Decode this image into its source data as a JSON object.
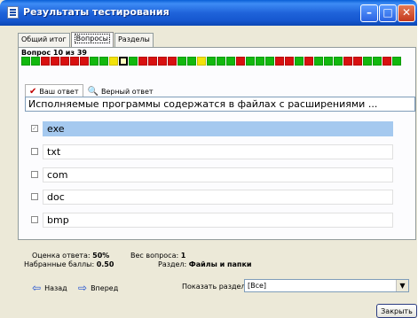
{
  "window": {
    "title": "Результаты тестирования",
    "controls": {
      "minimize": "–",
      "maximize": "□",
      "close": "✕"
    }
  },
  "tabs": [
    {
      "label": "Общий итог",
      "active": false
    },
    {
      "label": "Вопросы",
      "active": true
    },
    {
      "label": "Разделы",
      "active": false
    }
  ],
  "question_counter": "Вопрос 10 из 39",
  "question_grid": [
    "g",
    "g",
    "r",
    "r",
    "r",
    "r",
    "r",
    "g",
    "g",
    "y",
    "cur",
    "g",
    "r",
    "r",
    "r",
    "r",
    "g",
    "g",
    "y",
    "g",
    "g",
    "g",
    "r",
    "g",
    "g",
    "g",
    "r",
    "r",
    "g",
    "r",
    "g",
    "g",
    "g",
    "r",
    "r",
    "g",
    "g",
    "r",
    "g"
  ],
  "colors": {
    "correct": "#12b80e",
    "wrong": "#d81010",
    "partial": "#f2e20a",
    "selected_answer": "#a5c9ef"
  },
  "answer_tabs": [
    {
      "label": "Ваш ответ",
      "icon": "check-icon",
      "active": true
    },
    {
      "label": "Верный ответ",
      "icon": "magnifier-icon",
      "active": false
    }
  ],
  "question_text": "Исполняемые программы содержатся в файлах с расширениями ...",
  "answers": [
    {
      "text": "exe",
      "checked": true,
      "selected": true
    },
    {
      "text": "txt",
      "checked": false,
      "selected": false
    },
    {
      "text": "com",
      "checked": false,
      "selected": false
    },
    {
      "text": "doc",
      "checked": false,
      "selected": false
    },
    {
      "text": "bmp",
      "checked": false,
      "selected": false
    }
  ],
  "stats": {
    "score_label": "Оценка ответа:",
    "score_value": "50%",
    "points_label": "Набранные баллы:",
    "points_value": "0.50",
    "weight_label": "Вес вопроса:",
    "weight_value": "1",
    "section_label": "Раздел:",
    "section_value": "Файлы и папки"
  },
  "nav": {
    "back": "Назад",
    "forward": "Вперед"
  },
  "section_filter": {
    "label": "Показать раздел:",
    "value": "[Все]"
  },
  "close_button": "Закрыть"
}
